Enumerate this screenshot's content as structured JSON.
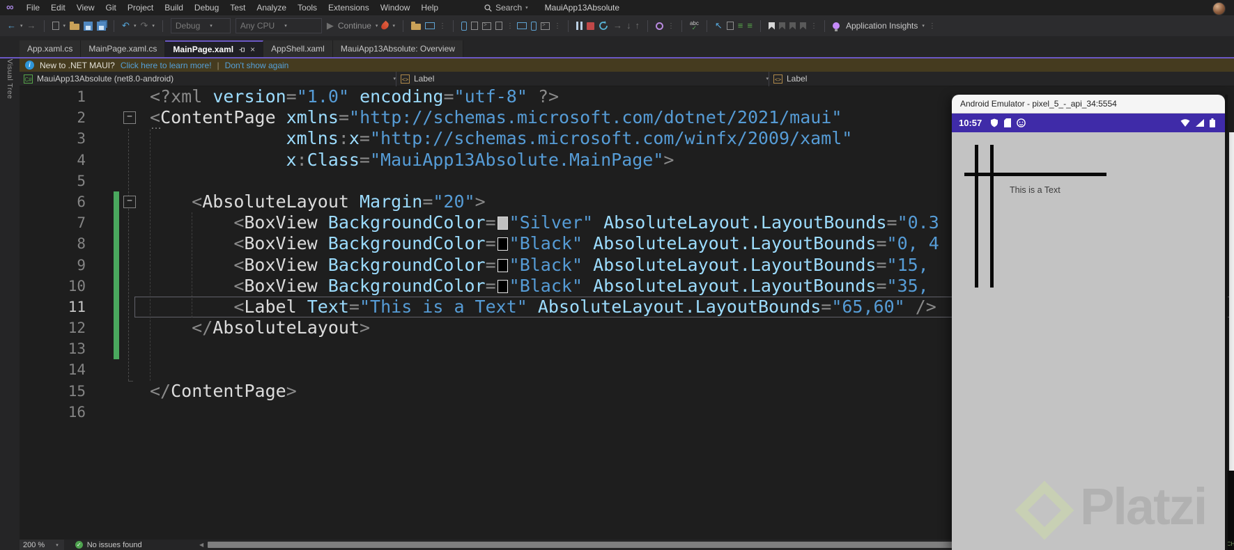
{
  "titlebar": {
    "app_title": "MauiApp13Absolute",
    "search_label": "Search",
    "menus": [
      "File",
      "Edit",
      "View",
      "Git",
      "Project",
      "Build",
      "Debug",
      "Test",
      "Analyze",
      "Tools",
      "Extensions",
      "Window",
      "Help"
    ]
  },
  "toolbar": {
    "config_selector": "Debug",
    "platform_selector": "Any CPU",
    "continue_label": "Continue",
    "app_insights_label": "Application Insights"
  },
  "tabs": [
    {
      "label": "App.xaml.cs",
      "active": false
    },
    {
      "label": "MainPage.xaml.cs",
      "active": false
    },
    {
      "label": "MainPage.xaml",
      "active": true
    },
    {
      "label": "AppShell.xaml",
      "active": false
    },
    {
      "label": "MauiApp13Absolute: Overview",
      "active": false
    }
  ],
  "side_tab_label": "Live Visual Tree",
  "infobar": {
    "message": "New to .NET MAUI?",
    "link_learn": "Click here to learn more!",
    "separator": "|",
    "link_dismiss": "Don't show again"
  },
  "breadcrumb": {
    "project": "MauiApp13Absolute (net8.0-android)",
    "type_label": "Label",
    "member_label": "Label"
  },
  "editor": {
    "lines": [
      {
        "num": 1,
        "ind": 0,
        "tokens": [
          [
            "<?xml ",
            "d"
          ],
          [
            "version",
            "a"
          ],
          [
            "=",
            "d"
          ],
          [
            "\"1.0\"",
            "s"
          ],
          [
            " ",
            "d"
          ],
          [
            "encoding",
            "a"
          ],
          [
            "=",
            "d"
          ],
          [
            "\"utf-8\"",
            "s"
          ],
          [
            " ?>",
            "d"
          ]
        ]
      },
      {
        "num": 2,
        "ind": 0,
        "fold": true,
        "tokens": [
          [
            "<",
            "d"
          ],
          [
            "ContentPage",
            "t"
          ],
          [
            " ",
            "d"
          ],
          [
            "xmlns",
            "a"
          ],
          [
            "=",
            "d"
          ],
          [
            "\"http://schemas.microsoft.com/dotnet/2021/maui\"",
            "s"
          ]
        ]
      },
      {
        "num": 3,
        "ind": 13,
        "tokens": [
          [
            "xmlns",
            "a"
          ],
          [
            ":",
            "d"
          ],
          [
            "x",
            "a"
          ],
          [
            "=",
            "d"
          ],
          [
            "\"http://schemas.microsoft.com/winfx/2009/xaml\"",
            "s"
          ]
        ]
      },
      {
        "num": 4,
        "ind": 13,
        "tokens": [
          [
            "x",
            "a"
          ],
          [
            ":",
            "d"
          ],
          [
            "Class",
            "a"
          ],
          [
            "=",
            "d"
          ],
          [
            "\"MauiApp13Absolute.MainPage\"",
            "s"
          ],
          [
            ">",
            "d"
          ]
        ]
      },
      {
        "num": 5,
        "ind": 0,
        "tokens": []
      },
      {
        "num": 6,
        "ind": 4,
        "fold": true,
        "chg": true,
        "tokens": [
          [
            "<",
            "d"
          ],
          [
            "AbsoluteLayout",
            "t"
          ],
          [
            " ",
            "d"
          ],
          [
            "Margin",
            "a"
          ],
          [
            "=",
            "d"
          ],
          [
            "\"20\"",
            "s"
          ],
          [
            ">",
            "d"
          ]
        ]
      },
      {
        "num": 7,
        "ind": 8,
        "chg": true,
        "tokens": [
          [
            "<",
            "d"
          ],
          [
            "BoxView",
            "t"
          ],
          [
            " ",
            "d"
          ],
          [
            "BackgroundColor",
            "a"
          ],
          [
            "=",
            "d"
          ],
          [
            "",
            "w-silver"
          ],
          [
            "\"Silver\"",
            "s"
          ],
          [
            " ",
            "d"
          ],
          [
            "AbsoluteLayout.LayoutBounds",
            "a"
          ],
          [
            "=",
            "d"
          ],
          [
            "\"0.3",
            "s"
          ]
        ]
      },
      {
        "num": 8,
        "ind": 8,
        "chg": true,
        "tokens": [
          [
            "<",
            "d"
          ],
          [
            "BoxView",
            "t"
          ],
          [
            " ",
            "d"
          ],
          [
            "BackgroundColor",
            "a"
          ],
          [
            "=",
            "d"
          ],
          [
            "",
            "w-black"
          ],
          [
            "\"Black\"",
            "s"
          ],
          [
            " ",
            "d"
          ],
          [
            "AbsoluteLayout.LayoutBounds",
            "a"
          ],
          [
            "=",
            "d"
          ],
          [
            "\"0, 4",
            "s"
          ]
        ]
      },
      {
        "num": 9,
        "ind": 8,
        "chg": true,
        "tokens": [
          [
            "<",
            "d"
          ],
          [
            "BoxView",
            "t"
          ],
          [
            " ",
            "d"
          ],
          [
            "BackgroundColor",
            "a"
          ],
          [
            "=",
            "d"
          ],
          [
            "",
            "w-black"
          ],
          [
            "\"Black\"",
            "s"
          ],
          [
            " ",
            "d"
          ],
          [
            "AbsoluteLayout.LayoutBounds",
            "a"
          ],
          [
            "=",
            "d"
          ],
          [
            "\"15,",
            "s"
          ]
        ]
      },
      {
        "num": 10,
        "ind": 8,
        "chg": true,
        "tokens": [
          [
            "<",
            "d"
          ],
          [
            "BoxView",
            "t"
          ],
          [
            " ",
            "d"
          ],
          [
            "BackgroundColor",
            "a"
          ],
          [
            "=",
            "d"
          ],
          [
            "",
            "w-black"
          ],
          [
            "\"Black\"",
            "s"
          ],
          [
            " ",
            "d"
          ],
          [
            "AbsoluteLayout.LayoutBounds",
            "a"
          ],
          [
            "=",
            "d"
          ],
          [
            "\"35,",
            "s"
          ]
        ]
      },
      {
        "num": 11,
        "ind": 8,
        "chg": true,
        "cur": true,
        "tokens": [
          [
            "<",
            "d"
          ],
          [
            "Label",
            "t"
          ],
          [
            " ",
            "d"
          ],
          [
            "Text",
            "a"
          ],
          [
            "=",
            "d"
          ],
          [
            "\"This is a Text\"",
            "s"
          ],
          [
            " ",
            "d"
          ],
          [
            "AbsoluteLayout.LayoutBounds",
            "a"
          ],
          [
            "=",
            "d"
          ],
          [
            "\"65,60\"",
            "s"
          ],
          [
            " />",
            "d"
          ]
        ]
      },
      {
        "num": 12,
        "ind": 4,
        "chg": true,
        "tokens": [
          [
            "</",
            "d"
          ],
          [
            "AbsoluteLayout",
            "t"
          ],
          [
            ">",
            "d"
          ]
        ]
      },
      {
        "num": 13,
        "ind": 0,
        "chg": true,
        "tokens": []
      },
      {
        "num": 14,
        "ind": 0,
        "tokens": []
      },
      {
        "num": 15,
        "ind": 0,
        "tokens": [
          [
            "</",
            "d"
          ],
          [
            "ContentPage",
            "t"
          ],
          [
            ">",
            "d"
          ]
        ]
      },
      {
        "num": 16,
        "ind": 0,
        "tokens": []
      }
    ]
  },
  "statusbar": {
    "zoom_level": "200 %",
    "issues": "No issues found"
  },
  "emulator": {
    "window_title": "Android Emulator - pixel_5_-_api_34:5554",
    "status_time": "10:57",
    "screen_label": "This is a Text",
    "watermark": "Platzi"
  },
  "overlay": {
    "keyboard_indicator": "CH"
  },
  "colors": {
    "accent_purple": "#6B58C5",
    "infobar_bg": "#453B1F",
    "maui_statusbar_purple": "#3F2BA8",
    "screen_silver": "#C3C3C3",
    "change_bar_green": "#4AA85E",
    "string_blue": "#569CD6",
    "attr_blue": "#9CDCFE"
  }
}
